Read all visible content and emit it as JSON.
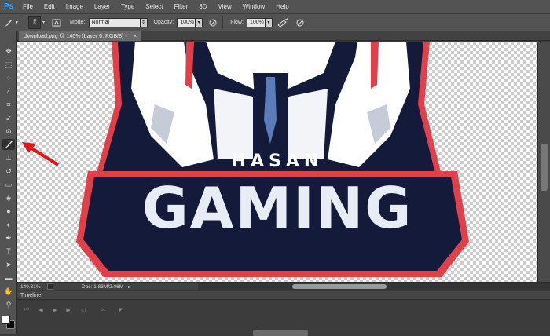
{
  "app": {
    "logo": "Ps"
  },
  "menu": [
    "File",
    "Edit",
    "Image",
    "Layer",
    "Type",
    "Select",
    "Filter",
    "3D",
    "View",
    "Window",
    "Help"
  ],
  "options": {
    "brush_size": "8",
    "mode_label": "Mode:",
    "mode_value": "Normal",
    "opacity_label": "Opacity:",
    "opacity_value": "100%",
    "flow_label": "Flow:",
    "flow_value": "100%"
  },
  "document": {
    "tab_title": "download.png @ 140% (Layer 0, RGB/8) *",
    "tab_close": "×"
  },
  "artwork": {
    "line1": "HASAN",
    "line2": "GAMING"
  },
  "status": {
    "zoom": "140.31%",
    "doc_info": "Doc: 1.83M/2.06M"
  },
  "timeline": {
    "label": "Timeline"
  },
  "colors": {
    "foreground": "#ffffff",
    "background": "#000000",
    "logo_navy": "#141a3a",
    "logo_red": "#e0404a",
    "annotation_arrow": "#e01818"
  }
}
